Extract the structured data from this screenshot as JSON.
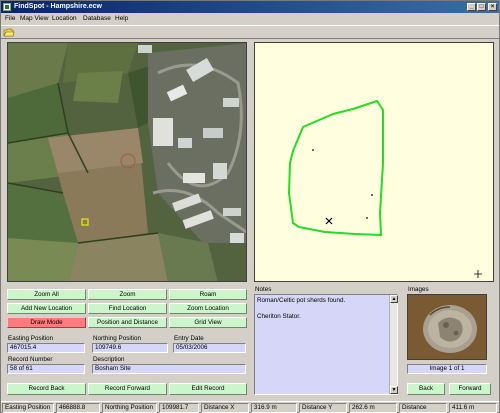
{
  "window": {
    "title": "FindSpot - Hampshire.ecw"
  },
  "menu": [
    "File",
    "Map View",
    "Location",
    "Database",
    "Help"
  ],
  "buttons": {
    "zoom_all": "Zoom All",
    "zoom": "Zoom",
    "roam": "Roam",
    "add_new_location": "Add New Location",
    "find_location": "Find Location",
    "zoom_location": "Zoom Location",
    "draw_mode": "Draw Mode",
    "position_and_distance": "Position and Distance",
    "grid_view": "Grid View",
    "record_back": "Record Back",
    "record_forward": "Record Forward",
    "edit_record": "Edit Record",
    "back": "Back",
    "forward": "Forward"
  },
  "fields": {
    "easting_label": "Easting Position",
    "easting_value": "467015.4",
    "northing_label": "Northing Position",
    "northing_value": "109749.6",
    "entry_date_label": "Entry Date",
    "entry_date_value": "05/03/2006",
    "record_number_label": "Record Number",
    "record_number_value": "58 of 61",
    "description_label": "Description",
    "description_value": "Bosham Site"
  },
  "notes": {
    "label": "Notes",
    "line1": "Roman/Celtic pot sherds found.",
    "line2": "Cheriton Stator."
  },
  "images": {
    "label": "Images",
    "count": "Image 1 of 1"
  },
  "status": {
    "easting_label": "Easting Position",
    "easting_value": "466888.8",
    "northing_label": "Northing Position",
    "northing_value": "109981.7",
    "distx_label": "Distance X",
    "distx_value": "316.9 m",
    "disty_label": "Distance Y",
    "disty_value": "262.6 m",
    "dist_label": "Distance",
    "dist_value": "411.6 m"
  },
  "colors": {
    "button_green": "#ccf5cc",
    "button_red": "#ff7a7a",
    "field_lilac": "#d6d6f8",
    "map_bg": "#ffffe0",
    "boundary": "#22dd22"
  }
}
